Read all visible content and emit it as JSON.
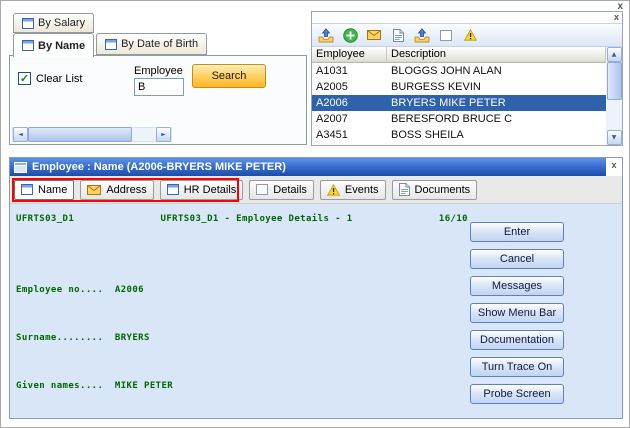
{
  "window": {
    "close_label": "x"
  },
  "icons": {
    "scroll_left": "◄",
    "scroll_right": "►",
    "scroll_up": "▲",
    "scroll_down": "▼"
  },
  "colors": {
    "selection": "#2f62ad",
    "title_bar": "#2a5fc0",
    "annotation": "#ff0000",
    "terminal_text": "#006600",
    "search_button": "#ffc13d"
  },
  "search_panel": {
    "tabs": [
      {
        "label": "By Salary",
        "icon": "form-icon"
      },
      {
        "label": "By Name",
        "icon": "form-icon",
        "selected": true
      },
      {
        "label": "By Date of Birth",
        "icon": "form-icon"
      }
    ],
    "clear_list_label": "Clear List",
    "clear_list_checked": true,
    "employee_label": "Employee",
    "employee_value": "B",
    "search_button_label": "Search"
  },
  "list_panel": {
    "close_label": "x",
    "toolbar_icons": [
      "upload-tray-icon",
      "add-icon",
      "mail-icon",
      "document-icon",
      "upload-tray-icon",
      "blank-window-icon",
      "warning-icon"
    ],
    "columns": [
      "Employee",
      "Description"
    ],
    "rows": [
      {
        "employee": "A1031",
        "description": "BLOGGS JOHN ALAN",
        "selected": false
      },
      {
        "employee": "A2005",
        "description": "BURGESS KEVIN",
        "selected": false
      },
      {
        "employee": "A2006",
        "description": "BRYERS MIKE PETER",
        "selected": true
      },
      {
        "employee": "A2007",
        "description": "BERESFORD BRUCE C",
        "selected": false
      },
      {
        "employee": "A3451",
        "description": "BOSS SHEILA",
        "selected": false
      }
    ]
  },
  "detail_panel": {
    "title": "Employee : Name (A2006-BRYERS MIKE PETER)",
    "close_label": "x",
    "tabs": [
      {
        "label": "Name",
        "icon": "form-icon",
        "selected": true
      },
      {
        "label": "Address",
        "icon": "mail-icon"
      },
      {
        "label": "HR Details",
        "icon": "form-icon"
      },
      {
        "label": "Details",
        "icon": "blank-window-icon"
      },
      {
        "label": "Events",
        "icon": "warning-icon"
      },
      {
        "label": "Documents",
        "icon": "document-icon"
      }
    ],
    "screen": {
      "header_left": "UFRTS03_D1",
      "header_center": "UFRTS03_D1 - Employee Details - 1",
      "header_right": "16/10",
      "lines": [
        "Employee no....  A2006",
        "Surname........  BRYERS",
        "Given names....  MIKE PETER"
      ]
    },
    "buttons": [
      {
        "label": "Enter"
      },
      {
        "label": "Cancel"
      },
      {
        "label": "Messages"
      },
      {
        "label": "Show Menu Bar"
      },
      {
        "label": "Documentation"
      },
      {
        "label": "Turn Trace On"
      },
      {
        "label": "Probe Screen"
      }
    ]
  }
}
